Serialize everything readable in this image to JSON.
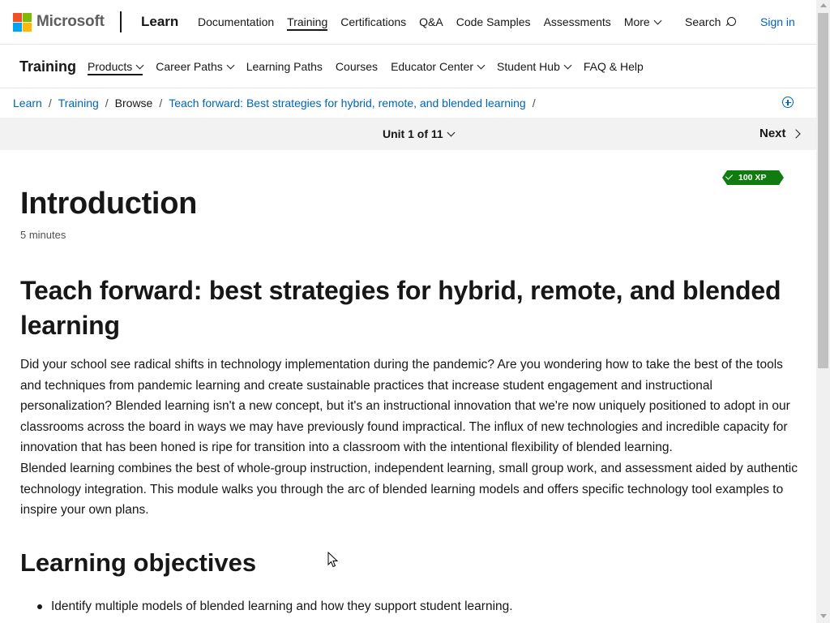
{
  "header": {
    "brand": "Microsoft",
    "product": "Learn",
    "nav": [
      {
        "label": "Documentation"
      },
      {
        "label": "Training"
      },
      {
        "label": "Certifications"
      },
      {
        "label": "Q&A"
      },
      {
        "label": "Code Samples"
      },
      {
        "label": "Assessments"
      },
      {
        "label": "More"
      }
    ],
    "search_label": "Search",
    "sign_in_label": "Sign in"
  },
  "subnav": {
    "title": "Training",
    "items": [
      {
        "label": "Products"
      },
      {
        "label": "Career Paths"
      },
      {
        "label": "Learning Paths"
      },
      {
        "label": "Courses"
      },
      {
        "label": "Educator Center"
      },
      {
        "label": "Student Hub"
      },
      {
        "label": "FAQ & Help"
      }
    ]
  },
  "breadcrumb": {
    "items": [
      {
        "label": "Learn"
      },
      {
        "label": "Training"
      },
      {
        "label": "Browse"
      },
      {
        "label": "Teach forward: Best strategies for hybrid, remote, and blended learning"
      }
    ],
    "separator": "/"
  },
  "unit_bar": {
    "unit_label": "Unit 1 of 11",
    "next_label": "Next"
  },
  "xp_badge": "100 XP",
  "content": {
    "title": "Introduction",
    "duration": "5 minutes",
    "module_heading": "Teach forward: best strategies for hybrid, remote, and blended learning",
    "paragraph_1": "Did your school see radical shifts in technology implementation during the pandemic? Are you wondering how to take the best of the tools and techniques from pandemic learning and create sustainable practices that increase student engagement and instructional personalization? Blended learning isn't a new concept, but it's an instructional innovation that we're now uniquely positioned to adopt in our classrooms across the board in ways we may have previously found impractical. The influx of new technologies and incredible capacity for innovation that has been honed is ripe for transition into a classroom with the intentional flexibility of blended learning.",
    "paragraph_2": "Blended learning combines the best of whole-group instruction, independent learning, small group work, and assessment aided by authentic technology integration. This module walks you through the arc of blended learning models and offers specific technology tool examples to inspire your own plans.",
    "objectives_heading": "Learning objectives",
    "objectives": [
      "Identify multiple models of blended learning and how they support student learning."
    ]
  },
  "colors": {
    "logo_red": "#f25022",
    "logo_green": "#7fba00",
    "logo_blue": "#00a4ef",
    "logo_yellow": "#ffb900",
    "link_blue": "#0065b3",
    "xp_green": "#107c10"
  }
}
